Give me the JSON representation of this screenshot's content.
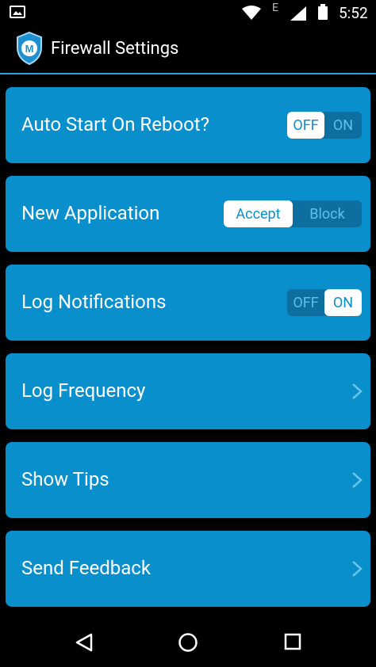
{
  "status_bar": {
    "network_letter": "E",
    "time": "5:52",
    "icons": [
      "gallery-icon",
      "wifi-icon",
      "signal-icon",
      "battery-icon"
    ]
  },
  "app_bar": {
    "title": "Firewall Settings",
    "logo": "shield-logo-icon"
  },
  "settings": [
    {
      "label": "Auto Start On Reboot?",
      "type": "toggle",
      "options": [
        "OFF",
        "ON"
      ],
      "selected": "OFF"
    },
    {
      "label": "New Application",
      "type": "toggle",
      "options": [
        "Accept",
        "Block"
      ],
      "selected": "Accept"
    },
    {
      "label": "Log Notifications",
      "type": "toggle",
      "options": [
        "OFF",
        "ON"
      ],
      "selected": "ON"
    },
    {
      "label": "Log Frequency",
      "type": "link",
      "icon": "chevron-right-icon"
    },
    {
      "label": "Show Tips",
      "type": "link",
      "icon": "chevron-right-icon"
    },
    {
      "label": "Send Feedback",
      "type": "link",
      "icon": "chevron-right-icon"
    }
  ],
  "colors": {
    "card": "#0a8fcd",
    "toggle_track": "#0c6f9f",
    "accent_line": "#2aa6df",
    "background": "#000000"
  },
  "nav_bar": {
    "icons": [
      "back-icon",
      "home-icon",
      "recents-icon"
    ]
  }
}
